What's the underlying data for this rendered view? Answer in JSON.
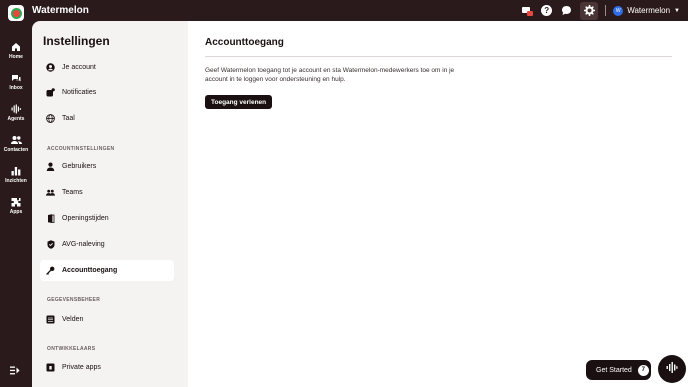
{
  "app": {
    "title": "Watermelon"
  },
  "topbar": {
    "account_name": "Watermelon",
    "avatar_initials": "W"
  },
  "rail": {
    "items": [
      {
        "label": "Home",
        "icon": "home-icon"
      },
      {
        "label": "Inbox",
        "icon": "inbox-icon"
      },
      {
        "label": "Agents",
        "icon": "agents-icon"
      },
      {
        "label": "Contacten",
        "icon": "contacts-icon"
      },
      {
        "label": "Inzichten",
        "icon": "insights-icon"
      },
      {
        "label": "Apps",
        "icon": "apps-icon"
      }
    ]
  },
  "settings": {
    "title": "Instellingen",
    "items_top": [
      {
        "label": "Je account",
        "icon": "user-circle-icon"
      },
      {
        "label": "Notificaties",
        "icon": "bell-icon"
      },
      {
        "label": "Taal",
        "icon": "globe-icon"
      }
    ],
    "section_account": "ACCOUNTINSTELLINGEN",
    "items_account": [
      {
        "label": "Gebruikers",
        "icon": "user-icon"
      },
      {
        "label": "Teams",
        "icon": "team-icon"
      },
      {
        "label": "Openingstijden",
        "icon": "door-icon"
      },
      {
        "label": "AVG-naleving",
        "icon": "shield-icon"
      },
      {
        "label": "Accounttoegang",
        "icon": "key-icon",
        "active": true
      }
    ],
    "section_data": "GEGEVENSBEHEER",
    "items_data": [
      {
        "label": "Velden",
        "icon": "fields-icon"
      }
    ],
    "section_dev": "ONTWIKKELAARS",
    "items_dev": [
      {
        "label": "Private apps",
        "icon": "private-apps-icon"
      }
    ]
  },
  "main": {
    "title": "Accounttoegang",
    "description": "Geef Watermelon toegang tot je account en sta Watermelon-medewerkers toe om in je account in te loggen voor ondersteuning en hulp.",
    "grant_button": "Toegang verlenen"
  },
  "floating": {
    "get_started_label": "Get Started",
    "get_started_count": "7"
  },
  "colors": {
    "dark": "#2b1a1b",
    "panel": "#f5f2f2",
    "main_bg": "#ffffff",
    "accent_blue": "#2f6ee8"
  }
}
